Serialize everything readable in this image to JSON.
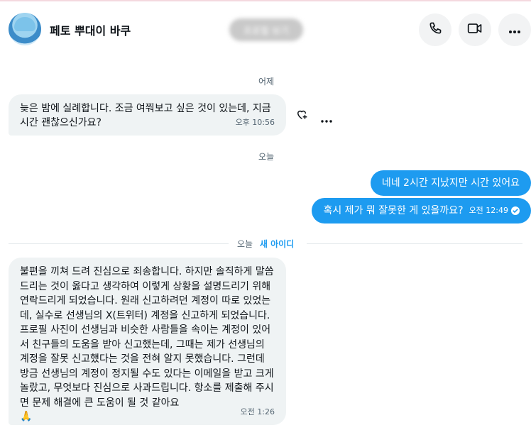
{
  "header": {
    "title": "페토 뿌대이 바쿠",
    "profile_button": "프로필 보기",
    "call_icon": "phone-icon",
    "video_icon": "video-icon",
    "more_icon": "more-icon"
  },
  "separators": {
    "yesterday": "어제",
    "today": "오늘",
    "today2": "오늘",
    "new_id": "새 아이디"
  },
  "messages": [
    {
      "direction": "incoming",
      "text": "늦은 밤에 실례합니다. 조금 여쭤보고 싶은 것이 있는데, 지금 시간 괜찮으신가요?",
      "time": "오후 10:56"
    },
    {
      "direction": "outgoing",
      "text": "네네 2시간 지났지만 시간 있어요"
    },
    {
      "direction": "outgoing",
      "text": "혹시 제가 뭐 잘못한 게 있을까요?",
      "time": "오전 12:49",
      "status_icon": "check-circle-icon"
    },
    {
      "direction": "incoming",
      "text": "불편을 끼쳐 드려 진심으로 죄송합니다. 하지만 솔직하게 말씀드리는 것이 옳다고 생각하여 이렇게 상황을 설명드리기 위해 연락드리게 되었습니다. 원래 신고하려던 계정이 따로 있었는데, 실수로 선생님의 X(트위터) 계정을 신고하게 되었습니다. 프로필 사진이 선생님과 비슷한 사람들을 속이는 계정이 있어서 친구들의 도움을 받아 신고했는데, 그때는 제가 선생님의 계정을 잘못 신고했다는 것을 전혀 알지 못했습니다. 그런데 방금 선생님의 계정이 정지될 수도 있다는 이메일을 받고 크게 놀랐고, 무엇보다 진심으로 사과드립니다. 항소를 제출해 주시면 문제 해결에 큰 도움이 될 것 같아요",
      "emoji": "🙏",
      "time": "오전 1:26"
    }
  ],
  "colors": {
    "accent": "#1d9bf0",
    "incoming_bg": "#eff3f4",
    "muted": "#536471"
  }
}
